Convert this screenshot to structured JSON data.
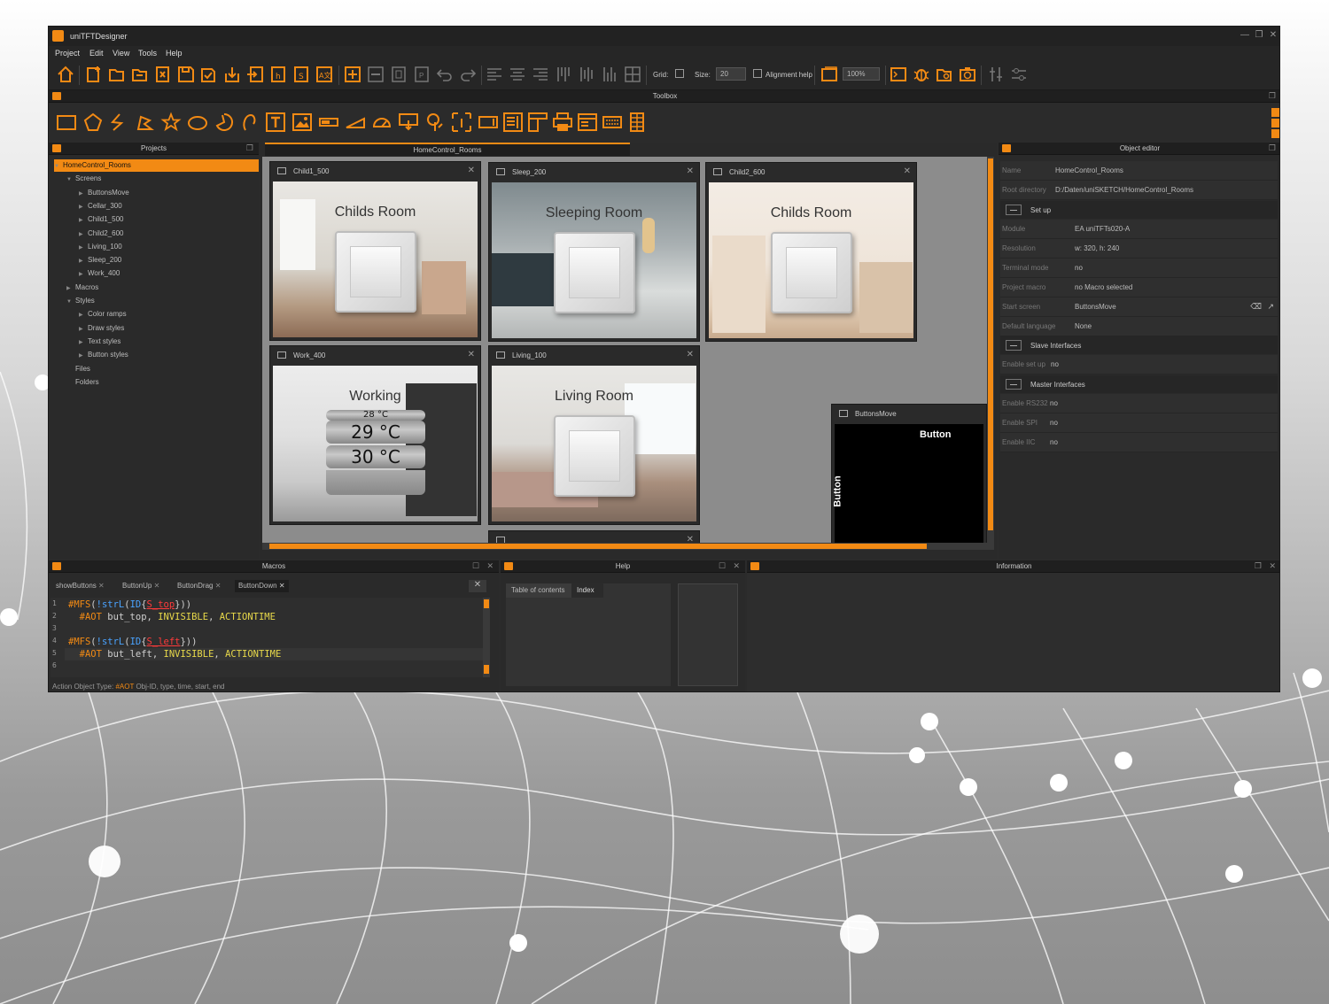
{
  "app": {
    "title": "uniTFTDesigner",
    "window_controls": [
      "—",
      "❐",
      "✕"
    ]
  },
  "menu": [
    "Project",
    "Edit",
    "View",
    "Tools",
    "Help"
  ],
  "toolbar": {
    "grid_label": "Grid:",
    "size_label": "Size:",
    "size_value": "20",
    "alignment_label": "Alignment help",
    "zoom_value": "100%"
  },
  "panels": {
    "toolbox": "Toolbox",
    "projects": "Projects",
    "object_editor": "Object editor",
    "macros": "Macros",
    "help": "Help",
    "information": "Information"
  },
  "projects_tree": [
    {
      "label": "HomeControl_Rooms",
      "level": 0,
      "selected": true
    },
    {
      "label": "Screens",
      "level": 1
    },
    {
      "label": "ButtonsMove",
      "level": 2
    },
    {
      "label": "Cellar_300",
      "level": 2
    },
    {
      "label": "Child1_500",
      "level": 2
    },
    {
      "label": "Child2_600",
      "level": 2
    },
    {
      "label": "Living_100",
      "level": 2
    },
    {
      "label": "Sleep_200",
      "level": 2
    },
    {
      "label": "Work_400",
      "level": 2
    },
    {
      "label": "Macros",
      "level": 1
    },
    {
      "label": "Styles",
      "level": 1
    },
    {
      "label": "Color ramps",
      "level": 2
    },
    {
      "label": "Draw styles",
      "level": 2
    },
    {
      "label": "Text styles",
      "level": 2
    },
    {
      "label": "Button styles",
      "level": 2
    },
    {
      "label": "Files",
      "level": 1
    },
    {
      "label": "Folders",
      "level": 1
    }
  ],
  "document_tab": "HomeControl_Rooms",
  "screens": {
    "child1": {
      "name": "Child1_500",
      "room": "Childs Room"
    },
    "sleep": {
      "name": "Sleep_200",
      "room": "Sleeping Room"
    },
    "child2": {
      "name": "Child2_600",
      "room": "Childs Room"
    },
    "work": {
      "name": "Work_400",
      "room": "Working",
      "temps": [
        "28 °C",
        "29 °C",
        "30 °C"
      ]
    },
    "living": {
      "name": "Living_100",
      "room": "Living Room"
    },
    "buttons": {
      "name": "ButtonsMove",
      "button_top": "Button",
      "button_side": "Button"
    }
  },
  "object_editor": {
    "name_key": "Name",
    "name_val": "HomeControl_Rooms",
    "root_key": "Root directory",
    "root_val": "D:/Daten/uniSKETCH/HomeControl_Rooms",
    "setup_group": "Set up",
    "module_key": "Module",
    "module_val": "EA uniTFTs020-A",
    "res_key": "Resolution",
    "res_val": "w: 320,  h: 240",
    "term_key": "Terminal mode",
    "term_val": "no",
    "macro_key": "Project macro",
    "macro_val": "no Macro selected",
    "start_key": "Start screen",
    "start_val": "ButtonsMove",
    "lang_key": "Default language",
    "lang_val": "None",
    "slave_group": "Slave Interfaces",
    "enable_setup_key": "Enable set up",
    "enable_setup_val": "no",
    "master_group": "Master Interfaces",
    "rs232_key": "Enable RS232",
    "rs232_val": "no",
    "spi_key": "Enable SPI",
    "spi_val": "no",
    "iic_key": "Enable IIC",
    "iic_val": "no"
  },
  "macros": {
    "tabs": [
      "showButtons",
      "ButtonUp",
      "ButtonDrag",
      "ButtonDown"
    ],
    "status_prefix": "Action Object Type:",
    "status_kw": "#AOT",
    "status_rest": "Obj-ID, type, time, start, end"
  },
  "help": {
    "tab_contents": "Table of contents",
    "tab_index": "Index"
  },
  "colors": {
    "accent": "#f28a14",
    "bg": "#2b2b2b"
  }
}
